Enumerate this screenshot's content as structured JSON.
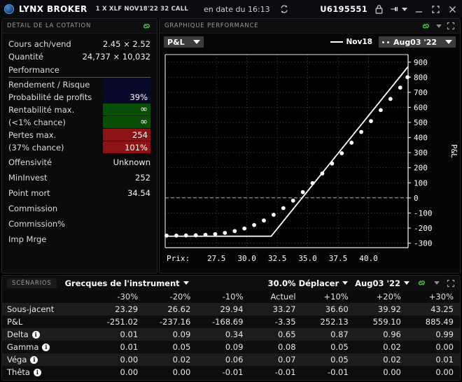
{
  "titlebar": {
    "brand": "LYNX BROKER",
    "contract": "1 X XLF NOV18'22 32 CALL",
    "time_label": "en date du 16:13",
    "account": "U6195551",
    "logo_icon": "globe-icon",
    "refresh_icon": "refresh-icon",
    "lock_icon": "lock-icon",
    "pin_icon": "pin-icon",
    "minimize_icon": "minimize-icon",
    "maximize_icon": "maximize-icon",
    "close_icon": "close-icon"
  },
  "quote_panel": {
    "header": "DÉTAIL DE LA COTATION",
    "link_icon": "link-icon",
    "rows": [
      {
        "label": "Cours ach/vend",
        "value": "2.45 × 2.52"
      },
      {
        "label": "Quantité",
        "value": "24,737 × 10,032"
      }
    ],
    "section_title": "Performance",
    "perf": {
      "rendement_label": "Rendement / Risque",
      "rendement_value": "",
      "proba_label": "Probabilité de profits",
      "proba_value": "39%",
      "renta_label": "Rentabilité max.",
      "renta_sub_label": "(<1% chance)",
      "renta_value": "∞",
      "renta_sub_value": "∞",
      "pertes_label": "Pertes max.",
      "pertes_sub_label": "(37% chance)",
      "pertes_value": "254",
      "pertes_sub_value": "101%"
    },
    "tail_rows": [
      {
        "label": "Offensivité",
        "value": "Unknown"
      },
      {
        "label": "MinInvest",
        "value": "252"
      },
      {
        "label": "Point mort",
        "value": "34.54"
      },
      {
        "label": "Commission",
        "value": ""
      },
      {
        "label": "Commission%",
        "value": ""
      },
      {
        "label": "Imp Mrge",
        "value": ""
      }
    ],
    "colors": {
      "navy": "#080828",
      "green": "#0a4f08",
      "red": "#8d1216"
    }
  },
  "chart_panel": {
    "header": "GRAPHIQUE PERFORMANCE",
    "link_icon": "link-icon",
    "caret_icon": "chevron-down-icon",
    "expand_icon": "expand-icon",
    "metric_dropdown": "P&L",
    "legend_line_label": "Nov18",
    "legend_dots_label": "Aug03 '22"
  },
  "chart_data": {
    "type": "line",
    "title": "GRAPHIQUE PERFORMANCE",
    "xlabel": "Prix:",
    "ylabel": "P&L",
    "xlim": [
      23.29,
      43.25
    ],
    "ylim": [
      -330,
      950
    ],
    "grid": true,
    "legend_position": "top-right",
    "x_ticks": [
      27.5,
      30.0,
      32.5,
      35.0,
      37.5,
      40.0
    ],
    "y_ticks": [
      -300,
      -200,
      -100,
      0,
      100,
      200,
      300,
      400,
      500,
      600,
      700,
      800,
      900
    ],
    "zero_line": 0,
    "series": [
      {
        "name": "Nov18",
        "style": "solid-line",
        "color": "#ffffff",
        "x": [
          23.29,
          32.0,
          43.25
        ],
        "values": [
          -254,
          -254,
          870
        ]
      },
      {
        "name": "Aug03 '22",
        "style": "dotted",
        "color": "#ffffff",
        "x": [
          23.4,
          24.2,
          25.0,
          25.8,
          26.6,
          27.4,
          28.2,
          29.0,
          29.8,
          30.6,
          31.4,
          32.2,
          33.0,
          33.8,
          34.6,
          35.4,
          36.2,
          37.0,
          37.8,
          38.6,
          39.4,
          40.2,
          41.0,
          41.8,
          42.6,
          43.2
        ],
        "values": [
          -250,
          -250,
          -249,
          -248,
          -245,
          -240,
          -232,
          -220,
          -203,
          -180,
          -150,
          -112,
          -68,
          -18,
          38,
          98,
          162,
          228,
          296,
          366,
          437,
          509,
          582,
          656,
          731,
          800
        ]
      }
    ],
    "scenario_markers": {
      "x": [
        23.29,
        26.62,
        29.94,
        33.27,
        36.6,
        39.92,
        43.25
      ],
      "pnl": [
        -251.02,
        -237.16,
        -168.69,
        -3.35,
        252.13,
        559.1,
        885.49
      ]
    }
  },
  "scenarios_panel": {
    "tab": "SCÉNARIOS",
    "title": "Grecques de l'instrument",
    "move_control": "30.0% Déplacer",
    "date_control": "Aug03 '22",
    "link_icon": "link-icon",
    "caret_icon": "chevron-down-icon",
    "expand_icon": "expand-icon",
    "columns": [
      "",
      "-30%",
      "-20%",
      "-10%",
      "Actuel",
      "+10%",
      "+20%",
      "+30%"
    ],
    "rows": [
      {
        "label": "Sous-jacent",
        "info": false,
        "values": [
          "23.29",
          "26.62",
          "29.94",
          "33.27",
          "36.60",
          "39.92",
          "43.25"
        ]
      },
      {
        "label": "P&L",
        "info": false,
        "values": [
          "-251.02",
          "-237.16",
          "-168.69",
          "-3.35",
          "252.13",
          "559.10",
          "885.49"
        ]
      },
      {
        "label": "Delta",
        "info": true,
        "values": [
          "0.01",
          "0.09",
          "0.34",
          "0.65",
          "0.87",
          "0.96",
          "0.99"
        ]
      },
      {
        "label": "Gamma",
        "info": true,
        "values": [
          "0.01",
          "0.05",
          "0.09",
          "0.08",
          "0.05",
          "0.02",
          "0.00"
        ]
      },
      {
        "label": "Véga",
        "info": true,
        "values": [
          "0.00",
          "0.02",
          "0.06",
          "0.07",
          "0.05",
          "0.02",
          "0.01"
        ]
      },
      {
        "label": "Thêta",
        "info": true,
        "values": [
          "0.00",
          "0.00",
          "-0.01",
          "-0.01",
          "-0.01",
          "0.00",
          "0.00"
        ]
      }
    ],
    "info_glyph": "i"
  }
}
